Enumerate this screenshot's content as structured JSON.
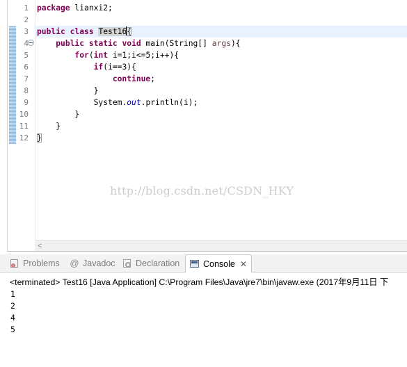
{
  "editor": {
    "lines": [
      {
        "no": "1",
        "tokens": [
          {
            "t": "package",
            "k": "kw"
          },
          {
            "t": " lianxi2;"
          }
        ]
      },
      {
        "no": "2",
        "tokens": []
      },
      {
        "no": "3",
        "tokens": [
          {
            "t": "public",
            "k": "kw"
          },
          {
            "t": " "
          },
          {
            "t": "class",
            "k": "kw"
          },
          {
            "t": " "
          },
          {
            "t": "Test16",
            "k": "hl"
          },
          {
            "t": "",
            "k": "caret"
          },
          {
            "t": "{",
            "k": "bracket"
          }
        ]
      },
      {
        "no": "4",
        "tokens": [
          {
            "t": "    "
          },
          {
            "t": "public",
            "k": "kw"
          },
          {
            "t": " "
          },
          {
            "t": "static",
            "k": "kw"
          },
          {
            "t": " "
          },
          {
            "t": "void",
            "k": "kw"
          },
          {
            "t": " main(String[] "
          },
          {
            "t": "args",
            "k": "param"
          },
          {
            "t": "){"
          }
        ],
        "fold": true
      },
      {
        "no": "5",
        "tokens": [
          {
            "t": "        "
          },
          {
            "t": "for",
            "k": "kw"
          },
          {
            "t": "("
          },
          {
            "t": "int",
            "k": "kw"
          },
          {
            "t": " i=1;i<=5;i++){"
          }
        ]
      },
      {
        "no": "6",
        "tokens": [
          {
            "t": "            "
          },
          {
            "t": "if",
            "k": "kw"
          },
          {
            "t": "(i==3){"
          }
        ]
      },
      {
        "no": "7",
        "tokens": [
          {
            "t": "                "
          },
          {
            "t": "continue",
            "k": "kw"
          },
          {
            "t": ";"
          }
        ]
      },
      {
        "no": "8",
        "tokens": [
          {
            "t": "            }"
          }
        ]
      },
      {
        "no": "9",
        "tokens": [
          {
            "t": "            System."
          },
          {
            "t": "out",
            "k": "fld"
          },
          {
            "t": ".println(i);"
          }
        ]
      },
      {
        "no": "10",
        "tokens": [
          {
            "t": "        }"
          }
        ]
      },
      {
        "no": "11",
        "tokens": [
          {
            "t": "    }"
          }
        ]
      },
      {
        "no": "12",
        "tokens": [
          {
            "t": "}",
            "k": "bracket"
          }
        ]
      }
    ],
    "watermark": "http://blog.csdn.net/CSDN_HKY",
    "scroll_left_glyph": "<"
  },
  "tabs": [
    {
      "label": "Problems",
      "icon": "problems-icon",
      "active": false
    },
    {
      "label": "Javadoc",
      "icon": "at-icon",
      "active": false
    },
    {
      "label": "Declaration",
      "icon": "declaration-icon",
      "active": false
    },
    {
      "label": "Console",
      "icon": "console-icon",
      "active": true
    }
  ],
  "tab_close_glyph": "✕",
  "console": {
    "header": "<terminated> Test16 [Java Application] C:\\Program Files\\Java\\jre7\\bin\\javaw.exe (2017年9月11日 下",
    "output": [
      "1",
      "2",
      "4",
      "5"
    ]
  },
  "colors": {
    "keyword": "#7f0055",
    "field": "#0000c0",
    "current_line": "#e8f2fe",
    "selection_highlight": "#d4d4d4"
  }
}
